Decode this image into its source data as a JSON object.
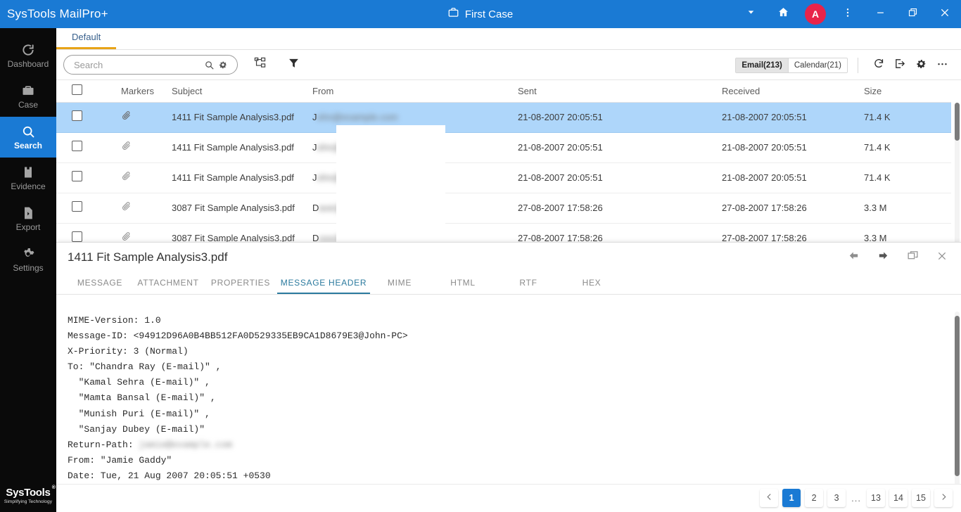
{
  "titlebar": {
    "app_title": "SysTools MailPro+",
    "case_name": "First Case",
    "case_icon": "briefcase-icon",
    "dropdown_icon": "chevron-down-icon",
    "home_icon": "home-icon",
    "avatar_letter": "A",
    "avatar_color": "#e8234a",
    "more_icon": "vertical-dots-icon",
    "minimize_icon": "minimize-icon",
    "restore_icon": "restore-icon",
    "close_icon": "close-icon",
    "bg_color": "#1a7ad4"
  },
  "sidebar": {
    "items": [
      {
        "label": "Dashboard",
        "icon": "dashboard-refresh-icon",
        "active": false
      },
      {
        "label": "Case",
        "icon": "briefcase-icon",
        "active": false
      },
      {
        "label": "Search",
        "icon": "magnifier-icon",
        "active": true
      },
      {
        "label": "Evidence",
        "icon": "evidence-bag-icon",
        "active": false
      },
      {
        "label": "Export",
        "icon": "export-file-icon",
        "active": false
      },
      {
        "label": "Settings",
        "icon": "gear-icon",
        "active": false
      }
    ],
    "brand": {
      "name": "SysTools",
      "trademark": "®",
      "tagline": "Simplifying Technology"
    }
  },
  "view_tabs": [
    {
      "label": "Default",
      "active": true
    }
  ],
  "toolbar": {
    "search": {
      "value": "",
      "placeholder": "Search"
    },
    "search_icon": "search-icon",
    "search_settings_icon": "gear-icon",
    "tree_icon": "hierarchy-tree-icon",
    "filter_icon": "funnel-filter-icon",
    "segments": [
      {
        "label": "Email(213)",
        "selected": true
      },
      {
        "label": "Calendar(21)",
        "selected": false
      }
    ],
    "right_icons": [
      {
        "name": "refresh-icon"
      },
      {
        "name": "export-icon"
      },
      {
        "name": "gear-icon"
      },
      {
        "name": "more-horizontal-icon"
      }
    ]
  },
  "grid": {
    "columns": [
      "",
      "Markers",
      "Subject",
      "From",
      "Sent",
      "Received",
      "Size"
    ],
    "select_all_checkbox": false,
    "rows": [
      {
        "checked": false,
        "marker_icon": "attachment-paperclip-icon",
        "subject": "1411 Fit Sample Analysis3.pdf",
        "from_visible": "J",
        "from_redacted": "ohn@example.com",
        "sent": "21-08-2007 20:05:51",
        "received": "21-08-2007 20:05:51",
        "size": "71.4 K",
        "selected": true
      },
      {
        "checked": false,
        "marker_icon": "attachment-paperclip-icon",
        "subject": "1411 Fit Sample Analysis3.pdf",
        "from_visible": "J",
        "from_redacted": "ohn@example.com",
        "sent": "21-08-2007 20:05:51",
        "received": "21-08-2007 20:05:51",
        "size": "71.4 K",
        "selected": false
      },
      {
        "checked": false,
        "marker_icon": "attachment-paperclip-icon",
        "subject": "1411 Fit Sample Analysis3.pdf",
        "from_visible": "J",
        "from_redacted": "ohn@example.com",
        "sent": "21-08-2007 20:05:51",
        "received": "21-08-2007 20:05:51",
        "size": "71.4 K",
        "selected": false
      },
      {
        "checked": false,
        "marker_icon": "attachment-paperclip-icon",
        "subject": "3087 Fit Sample Analysis3.pdf",
        "from_visible": "D",
        "from_redacted": "ave@example.com",
        "sent": "27-08-2007 17:58:26",
        "received": "27-08-2007 17:58:26",
        "size": "3.3 M",
        "selected": false
      },
      {
        "checked": false,
        "marker_icon": "attachment-paperclip-icon",
        "subject": "3087 Fit Sample Analysis3.pdf",
        "from_visible": "D",
        "from_redacted": "uuu@sotecorp.com",
        "sent": "27-08-2007 17:58:26",
        "received": "27-08-2007 17:58:26",
        "size": "3.3 M",
        "selected": false
      }
    ]
  },
  "detail": {
    "title": "1411 Fit Sample Analysis3.pdf",
    "head_icons": [
      {
        "name": "back-arrow-icon"
      },
      {
        "name": "forward-arrow-icon"
      },
      {
        "name": "popout-window-icon"
      },
      {
        "name": "close-icon"
      }
    ],
    "tabs": [
      {
        "label": "MESSAGE",
        "active": false
      },
      {
        "label": "ATTACHMENT",
        "active": false
      },
      {
        "label": "PROPERTIES",
        "active": false
      },
      {
        "label": "MESSAGE HEADER",
        "active": true
      },
      {
        "label": "MIME",
        "active": false
      },
      {
        "label": "HTML",
        "active": false
      },
      {
        "label": "RTF",
        "active": false
      },
      {
        "label": "HEX",
        "active": false
      }
    ],
    "header_lines": [
      "MIME-Version: 1.0",
      "Message-ID: <94912D96A0B4BB512FA0D529335EB9CA1D8679E3@John-PC>",
      "X-Priority: 3 (Normal)",
      "To: \"Chandra Ray (E-mail)\" ,",
      "  \"Kamal Sehra (E-mail)\" ,",
      "  \"Mamta Bansal (E-mail)\" ,",
      "  \"Munish Puri (E-mail)\" ,",
      "  \"Sanjay Dubey (E-mail)\""
    ],
    "return_path_label": "Return-Path: ",
    "return_path_redacted": "jamie@example.com",
    "from_line": "From: \"Jamie Gaddy\"",
    "date_line": "Date: Tue, 21 Aug 2007 20:05:51 +0530"
  },
  "pagination": {
    "prev_icon": "chevron-left-icon",
    "next_icon": "chevron-right-icon",
    "pages": [
      "1",
      "2",
      "3",
      "...",
      "13",
      "14",
      "15"
    ],
    "current": "1"
  }
}
